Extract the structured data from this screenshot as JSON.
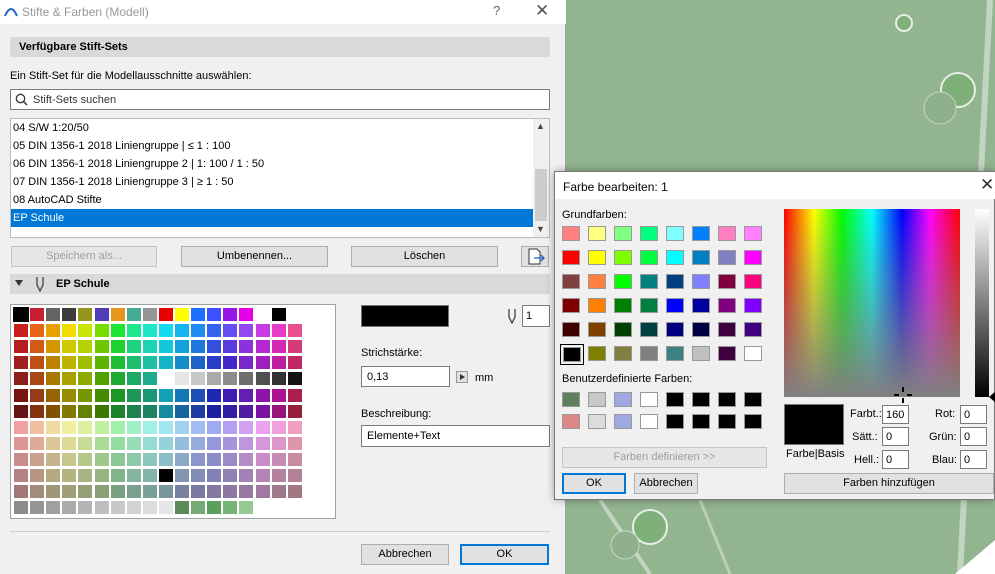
{
  "main_dialog": {
    "title": "Stifte & Farben (Modell)",
    "help_glyph": "?",
    "close_glyph": "✕",
    "sets_section_label": "Verfügbare Stift-Sets",
    "choose_label": "Ein Stift-Set für die Modellausschnitte auswählen:",
    "search_placeholder": "Stift-Sets suchen",
    "pen_sets": [
      {
        "label": "04 S/W 1:20/50",
        "selected": false
      },
      {
        "label": "05 DIN 1356-1 2018 Liniengruppe | ≤ 1 : 100",
        "selected": false
      },
      {
        "label": "06 DIN 1356-1 2018 Liniengruppe 2 | 1: 100 / 1 : 50",
        "selected": false
      },
      {
        "label": "07 DIN 1356-1 2018 Liniengruppe 3 | ≥ 1 : 50",
        "selected": false
      },
      {
        "label": "08 AutoCAD Stifte",
        "selected": false
      },
      {
        "label": "EP Schule",
        "selected": true
      }
    ],
    "buttons": {
      "save_as": "Speichern als...",
      "rename": "Umbenennen...",
      "delete": "Löschen",
      "cancel": "Abbrechen",
      "ok": "OK"
    },
    "pen_set_name": "EP Schule",
    "pen_number": "1",
    "stroke_label": "Strichstärke:",
    "stroke_value": "0,13",
    "stroke_unit": "mm",
    "description_label": "Beschreibung:",
    "description_value": "Elemente+Text",
    "selected_pen_color": "#000000"
  },
  "color_dialog": {
    "title": "Farbe bearbeiten:  1",
    "close_glyph": "✕",
    "basic_colors_label": "Grundfarben:",
    "basic_colors": [
      "#ff8080",
      "#ffff80",
      "#80ff80",
      "#00ff80",
      "#80ffff",
      "#0080ff",
      "#ff80c0",
      "#ff80ff",
      "#ff0000",
      "#ffff00",
      "#80ff00",
      "#00ff40",
      "#00ffff",
      "#0080c0",
      "#8080c0",
      "#ff00ff",
      "#804040",
      "#ff8040",
      "#00ff00",
      "#008080",
      "#004080",
      "#8080ff",
      "#800040",
      "#ff0080",
      "#800000",
      "#ff8000",
      "#008000",
      "#008040",
      "#0000ff",
      "#0000a0",
      "#800080",
      "#8000ff",
      "#400000",
      "#804000",
      "#004000",
      "#004040",
      "#000080",
      "#000040",
      "#400040",
      "#400080",
      "#000000",
      "#808000",
      "#808040",
      "#808080",
      "#408080",
      "#c0c0c0",
      "#400040",
      "#ffffff"
    ],
    "custom_colors_label": "Benutzerdefinierte Farben:",
    "custom_colors": [
      "#5f7f5f",
      "#c8c8c8",
      "#9fa8e0",
      "#ffffff",
      "#000000",
      "#000000",
      "#000000",
      "#000000",
      "#e08888",
      "#dcdcdc",
      "#9fa8e0",
      "#ffffff",
      "#000000",
      "#000000",
      "#000000",
      "#000000"
    ],
    "define_button": "Farben definieren >>",
    "ok": "OK",
    "cancel": "Abbrechen",
    "preview_label": "Farbe|Basis",
    "hue_label": "Farbt.:",
    "hue_value": "160",
    "sat_label": "Sätt.:",
    "sat_value": "0",
    "lum_label": "Hell.:",
    "lum_value": "0",
    "red_label": "Rot:",
    "red_value": "0",
    "green_label": "Grün:",
    "green_value": "0",
    "blue_label": "Blau:",
    "blue_value": "0",
    "add_button": "Farben hinzufügen"
  },
  "pen_palette": {
    "columns": 20,
    "rows": 13,
    "colors": [
      [
        "#000000",
        "#c81e32",
        "#646464",
        "#3c3c3c",
        "#96961e",
        "#503cb4",
        "#e6961e",
        "#46aa96",
        "#969696",
        "#e60000",
        "#ffff00",
        "#1e6eff",
        "#3c50ff",
        "#9614e6",
        "#e600e6",
        "#ffffff",
        "#000000",
        "#ffffff",
        "#ffffff",
        "#ffffff"
      ],
      [
        "#c81e1e",
        "#e66414",
        "#e6a000",
        "#f0dc00",
        "#c8e600",
        "#78dc00",
        "#1ee632",
        "#1ee68c",
        "#1ee6c8",
        "#14dcf0",
        "#14b4f0",
        "#1e8cf0",
        "#3264f0",
        "#6450f0",
        "#9646f0",
        "#c83ce6",
        "#e63cc8",
        "#e6508c",
        "#ffffff",
        "#ffffff"
      ],
      [
        "#b41e1e",
        "#d25a14",
        "#d29600",
        "#d2c800",
        "#b4d200",
        "#6ec800",
        "#1ed232",
        "#1ed282",
        "#1ed2b4",
        "#14c8dc",
        "#14a0dc",
        "#1e78dc",
        "#3250dc",
        "#5a3cdc",
        "#8c32dc",
        "#b428d2",
        "#d228b4",
        "#d23c78",
        "#ffffff",
        "#ffffff"
      ],
      [
        "#a01e1e",
        "#be5014",
        "#be8200",
        "#beb400",
        "#a0be00",
        "#5ab400",
        "#1ebe32",
        "#1ebe6e",
        "#1ebea0",
        "#14b4c8",
        "#148cc8",
        "#1e64c8",
        "#283cc8",
        "#4628c8",
        "#7828c8",
        "#a01ebe",
        "#be1ea0",
        "#be2864",
        "#ffffff",
        "#ffffff"
      ],
      [
        "#8c1e1e",
        "#aa4614",
        "#aa7800",
        "#aaa000",
        "#8caa00",
        "#50a000",
        "#1eaa32",
        "#1eaa64",
        "#1eaa8c",
        "#ffffff",
        "#e6e6e6",
        "#c8c8c8",
        "#aaaaaa",
        "#8c8c8c",
        "#6e6e6e",
        "#505050",
        "#323232",
        "#141414",
        "#ffffff",
        "#ffffff"
      ],
      [
        "#781414",
        "#963c14",
        "#966400",
        "#968c00",
        "#789600",
        "#468c00",
        "#1e9628",
        "#1e965a",
        "#1e9678",
        "#14a0b4",
        "#1478b4",
        "#1e50b4",
        "#1e28b4",
        "#3c1eb4",
        "#641eb4",
        "#8c14aa",
        "#aa1490",
        "#aa1e50",
        "#ffffff",
        "#ffffff"
      ],
      [
        "#641414",
        "#82320f",
        "#825000",
        "#827800",
        "#648200",
        "#3c7800",
        "#1e8228",
        "#1e8250",
        "#1e8264",
        "#148ca0",
        "#1464a0",
        "#1e3ca0",
        "#1e1ea0",
        "#321ea0",
        "#501ea0",
        "#7814a0",
        "#961478",
        "#961e3c",
        "#ffffff",
        "#ffffff"
      ],
      [
        "#f0a0a0",
        "#f0bea0",
        "#f0dca0",
        "#f0f0a0",
        "#dcf0a0",
        "#bef0a0",
        "#a0f0aa",
        "#a0f0c8",
        "#a0f0e6",
        "#a0e6f0",
        "#a0d2f0",
        "#a0bef0",
        "#a0aaf0",
        "#b4a0f0",
        "#d2a0f0",
        "#eba0f0",
        "#f0a0dc",
        "#f0a0be",
        "#ffffff",
        "#ffffff"
      ],
      [
        "#dc9696",
        "#dcaa96",
        "#dcc896",
        "#dcdc96",
        "#c8dc96",
        "#aadc96",
        "#96dca0",
        "#96dcb4",
        "#96dcd2",
        "#96d2dc",
        "#96bedc",
        "#96aadc",
        "#9696dc",
        "#a596dc",
        "#be96dc",
        "#d796dc",
        "#dc96c8",
        "#dc96aa",
        "#ffffff",
        "#ffffff"
      ],
      [
        "#c88c8c",
        "#c8a08c",
        "#c8b48c",
        "#c8c88c",
        "#b4c88c",
        "#a0c88c",
        "#8cc896",
        "#8cc8aa",
        "#8cc8be",
        "#8cbec8",
        "#8caac8",
        "#8c96c8",
        "#8c8cc8",
        "#9b8cc8",
        "#b48cc8",
        "#c88cc8",
        "#c88cb4",
        "#c88ca0",
        "#ffffff",
        "#ffffff"
      ],
      [
        "#b48282",
        "#b49682",
        "#b4aa82",
        "#b4b482",
        "#aab482",
        "#96b482",
        "#82b48c",
        "#82b4a0",
        "#82b4aa",
        "#000000",
        "#8296b4",
        "#828cb4",
        "#8282b4",
        "#9182b4",
        "#a082b4",
        "#b482b4",
        "#b482a0",
        "#b48296",
        "#ffffff",
        "#ffffff"
      ],
      [
        "#a07878",
        "#a08c78",
        "#a09678",
        "#a0a078",
        "#96a078",
        "#8ca078",
        "#78a082",
        "#78a08c",
        "#78a096",
        "#78969b",
        "#7882a0",
        "#7878a0",
        "#8278a0",
        "#8c78a0",
        "#9678a0",
        "#a078a0",
        "#a0788c",
        "#a07882",
        "#ffffff",
        "#ffffff"
      ],
      [
        "#8c8c8c",
        "#969696",
        "#a0a0a0",
        "#aaaaaa",
        "#b4b4b4",
        "#bebebe",
        "#c8c8c8",
        "#d2d2d2",
        "#dcdcdc",
        "#e6e6e6",
        "#5a8c5a",
        "#78aa78",
        "#5aa05a",
        "#78b478",
        "#96c896",
        "#ffffff",
        "#ffffff",
        "#ffffff",
        "#ffffff",
        "#ffffff"
      ]
    ]
  }
}
